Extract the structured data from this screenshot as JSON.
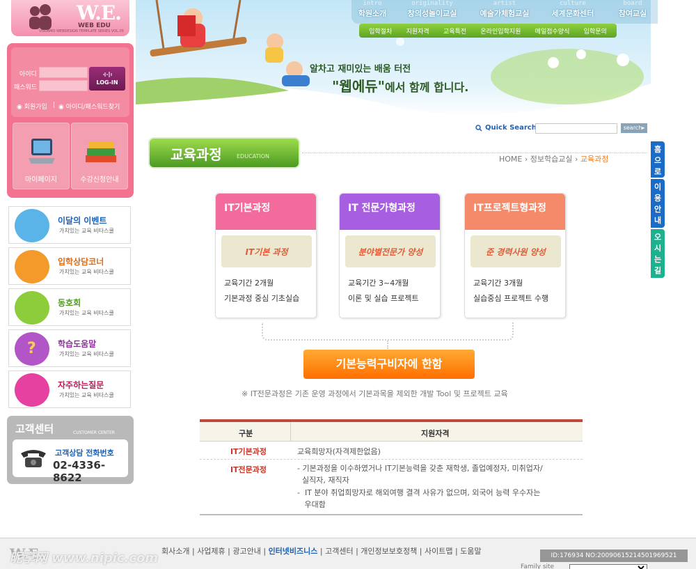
{
  "logo": {
    "name": "W.E.",
    "sub": "WEB EDU",
    "tiny": "VISUAMO WEBDESIGN TEMPLATE SERIES VOL.05"
  },
  "login": {
    "id_label": "아이디",
    "pw_label": "패스워드",
    "button": "LOG-IN",
    "join": "회원가입",
    "find": "아이디/패스워드찾기",
    "tiles": [
      "마이페이지",
      "수강신청안내"
    ]
  },
  "side_menu": [
    {
      "title": "이달의 이벤트",
      "sub": "가치있는 교육 비타스쿨",
      "color": "#1c62b6",
      "icon": "#5bb4e8"
    },
    {
      "title": "입학상담코너",
      "sub": "가치있는 교육 비타스쿨",
      "color": "#e06b14",
      "icon": "#f39a2b"
    },
    {
      "title": "동호회",
      "sub": "가치있는 교육 비타스쿨",
      "color": "#4f9a1f",
      "icon": "#8dcc3a"
    },
    {
      "title": "학습도움말",
      "sub": "가치있는 교육 비타스쿨",
      "color": "#8e2f9c",
      "icon": "#b255c7"
    },
    {
      "title": "자주하는질문",
      "sub": "가치있는 교육 비타스쿨",
      "color": "#c2185b",
      "icon": "#e640a0"
    }
  ],
  "customer_center": {
    "title": "고객센터",
    "en": "CUSTOMER CENTER",
    "label": "고객상담 전화번호",
    "phone": "02-4336-8622"
  },
  "nav": [
    {
      "en": "intro",
      "ko": "학원소개"
    },
    {
      "en": "originality",
      "ko": "창의성놀이교실"
    },
    {
      "en": "artist",
      "ko": "예술가체험교실"
    },
    {
      "en": "culture",
      "ko": "세계문화센터"
    },
    {
      "en": "board",
      "ko": "참여교실"
    }
  ],
  "subnav": [
    "입학절차",
    "지원자격",
    "교육특전",
    "온라인입학지원",
    "메일접수양식",
    "입학문의"
  ],
  "banner": {
    "line1": "알차고 재미있는 배움 터전",
    "line2_brand": "\"웹에듀\"",
    "line2_rest": "에서 함께 합니다."
  },
  "search": {
    "label": "Quick Search",
    "button": "search▸"
  },
  "page": {
    "title": "교육과정",
    "title_en": "EDUCATION"
  },
  "breadcrumb": {
    "home": "HOME",
    "mid": "정보학습교실",
    "current": "교육과정"
  },
  "quick_links": [
    "홈으로",
    "이용안내",
    "오시는길"
  ],
  "courses": [
    {
      "title": "IT기본과정",
      "hand": "IT기본 과정",
      "line1": "교육기간 2개월",
      "line2": "기본과정 중심 기초실습",
      "head": "#f26b9c",
      "hand_color": "#e05c3a"
    },
    {
      "title": "IT 전문가형과정",
      "hand": "분야별전문가 양성",
      "line1": "교육기간 3~4개월",
      "line2": "이론 및 실습 프로젝트",
      "head": "#a75ee0",
      "hand_color": "#e05c3a"
    },
    {
      "title": "IT프로젝트형과정",
      "hand": "준 경력사원 양성",
      "line1": "교육기간 3개월",
      "line2": "실습중심 프로젝트 수행",
      "head": "#f58a6a",
      "hand_color": "#e05c3a"
    }
  ],
  "cta": "기본능력구비자에 한함",
  "note": "※ IT전문과정은 기존 운영 과정에서 기본과목을 제외한 개발 Tool 및 프로젝트 교육",
  "table": {
    "headers": [
      "구분",
      "지원자격"
    ],
    "rows": [
      {
        "cat": "IT기본과정",
        "lines": [
          "교육희망자(자격제한없음)"
        ]
      },
      {
        "cat": "IT전문과정",
        "lines": [
          "- 기본과정을 이수하였거나 IT기본능력을 갖춘 재학생, 졸업예정자, 미취업자/",
          "  실직자, 재직자",
          "-  IT 분야 취업희망자로 해외여행 결격 사유가 없으며, 외국어 능력 우수자는",
          "   우대함"
        ]
      }
    ]
  },
  "footer": {
    "logo": "W.E.",
    "links": [
      "회사소개",
      "사업제휴",
      "광고안내",
      "인터넷비즈니스",
      "고객센터",
      "개인정보보호정책",
      "사이트맵",
      "도움말"
    ],
    "highlight": "인터넷비즈니스",
    "watermark": "昵享网 www.nipic.com",
    "id_text": "ID:176934 NO:20090615214501969521",
    "family_label": "Family site"
  }
}
